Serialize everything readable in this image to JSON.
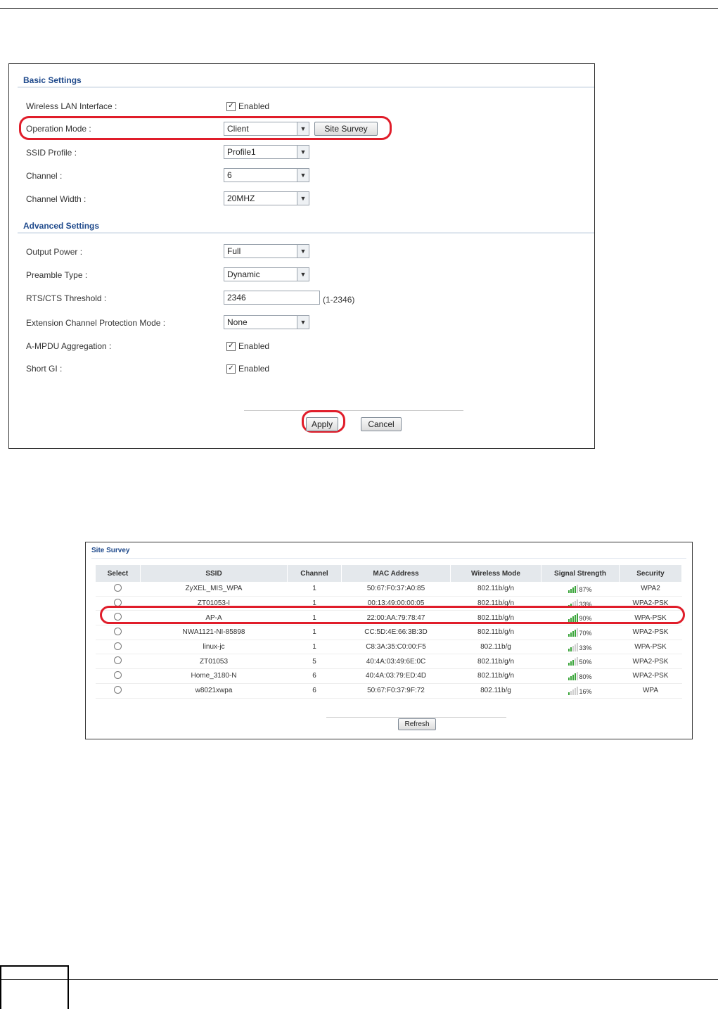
{
  "basic_settings": {
    "title": "Basic Settings",
    "wlan_label": "Wireless LAN Interface :",
    "wlan_enabled": "Enabled",
    "op_mode_label": "Operation Mode :",
    "op_mode_value": "Client",
    "site_survey_button": "Site Survey",
    "ssid_profile_label": "SSID Profile :",
    "ssid_profile_value": "Profile1",
    "channel_label": "Channel :",
    "channel_value": "6",
    "channel_width_label": "Channel Width :",
    "channel_width_value": "20MHZ"
  },
  "advanced_settings": {
    "title": "Advanced Settings",
    "output_power_label": "Output Power :",
    "output_power_value": "Full",
    "preamble_label": "Preamble Type :",
    "preamble_value": "Dynamic",
    "rts_label": "RTS/CTS Threshold :",
    "rts_value": "2346",
    "rts_hint": "(1-2346)",
    "ecpm_label": "Extension Channel Protection Mode :",
    "ecpm_value": "None",
    "ampdu_label": "A-MPDU Aggregation :",
    "ampdu_enabled": "Enabled",
    "shortgi_label": "Short GI :",
    "shortgi_enabled": "Enabled"
  },
  "actions": {
    "apply": "Apply",
    "cancel": "Cancel"
  },
  "site_survey": {
    "title": "Site Survey",
    "headers": [
      "Select",
      "SSID",
      "Channel",
      "MAC Address",
      "Wireless Mode",
      "Signal Strength",
      "Security"
    ],
    "rows": [
      {
        "ssid": "ZyXEL_MIS_WPA",
        "channel": "1",
        "mac": "50:67:F0:37:A0:85",
        "mode": "802.11b/g/n",
        "signal": "87%",
        "signal_level": 0.87,
        "security": "WPA2"
      },
      {
        "ssid": "ZT01053-I",
        "channel": "1",
        "mac": "00:13:49:00:00:05",
        "mode": "802.11b/g/n",
        "signal": "33%",
        "signal_level": 0.33,
        "security": "WPA2-PSK"
      },
      {
        "ssid": "AP-A",
        "channel": "1",
        "mac": "22:00:AA:79:78:47",
        "mode": "802.11b/g/n",
        "signal": "90%",
        "signal_level": 0.9,
        "security": "WPA-PSK"
      },
      {
        "ssid": "NWA1121-NI-85898",
        "channel": "1",
        "mac": "CC:5D:4E:66:3B:3D",
        "mode": "802.11b/g/n",
        "signal": "70%",
        "signal_level": 0.7,
        "security": "WPA2-PSK"
      },
      {
        "ssid": "linux-jc",
        "channel": "1",
        "mac": "C8:3A:35:C0:00:F5",
        "mode": "802.11b/g",
        "signal": "33%",
        "signal_level": 0.33,
        "security": "WPA-PSK"
      },
      {
        "ssid": "ZT01053",
        "channel": "5",
        "mac": "40:4A:03:49:6E:0C",
        "mode": "802.11b/g/n",
        "signal": "50%",
        "signal_level": 0.5,
        "security": "WPA2-PSK"
      },
      {
        "ssid": "Home_3180-N",
        "channel": "6",
        "mac": "40:4A:03:79:ED:4D",
        "mode": "802.11b/g/n",
        "signal": "80%",
        "signal_level": 0.8,
        "security": "WPA2-PSK"
      },
      {
        "ssid": "w8021xwpa",
        "channel": "6",
        "mac": "50:67:F0:37:9F:72",
        "mode": "802.11b/g",
        "signal": "16%",
        "signal_level": 0.16,
        "security": "WPA"
      }
    ],
    "refresh": "Refresh"
  },
  "colors": {
    "highlight": "#e01d2a",
    "section_title": "#1f4a8c",
    "signal_on": "#3aa53a",
    "signal_off": "#cfcfcf"
  }
}
